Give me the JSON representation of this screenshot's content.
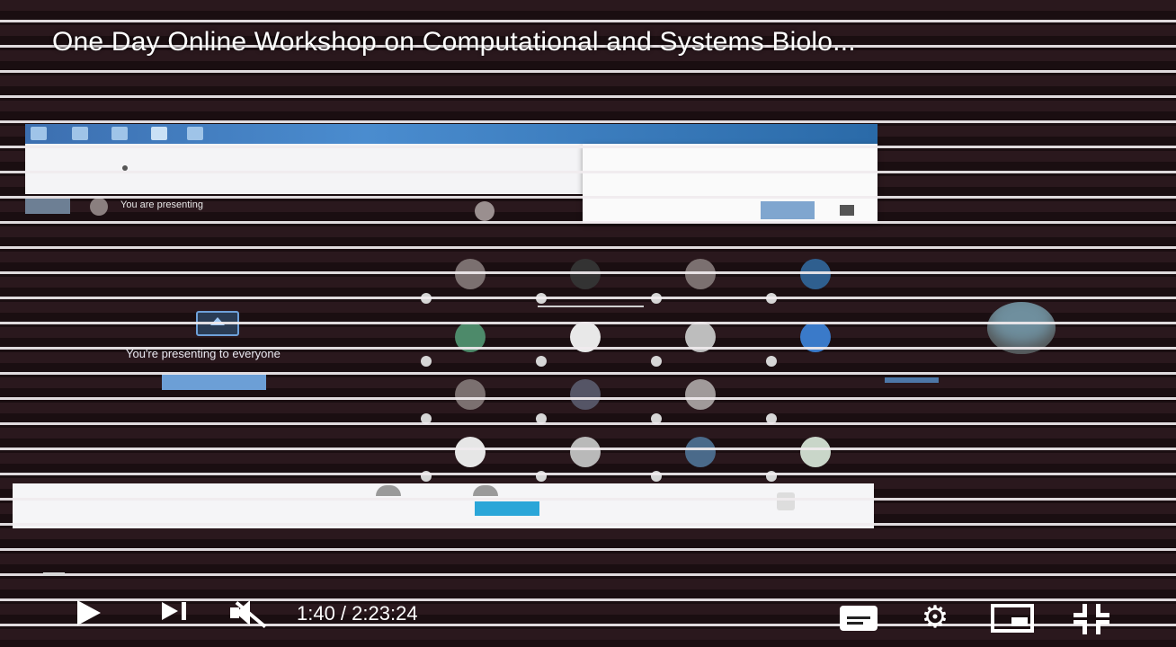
{
  "video": {
    "title": "One Day Online Workshop on Computational and Systems Biolo..."
  },
  "meeting": {
    "you_are_presenting": "You are presenting",
    "presenting_to_everyone": "You're presenting to everyone"
  },
  "player": {
    "current_time": "1:40",
    "duration": "2:23:24",
    "time_display": "1:40 / 2:23:24",
    "play_icon": "play-icon",
    "next_icon": "next-icon",
    "mute_icon": "volume-muted-icon",
    "subtitles_icon": "subtitles-icon",
    "settings_icon": "gear-icon",
    "miniplayer_icon": "miniplayer-icon",
    "fullscreen_icon": "exit-fullscreen-icon"
  },
  "colors": {
    "stripe": "#f0ebee",
    "background": "#1f1216",
    "accent_blue": "#6c9fd6"
  }
}
